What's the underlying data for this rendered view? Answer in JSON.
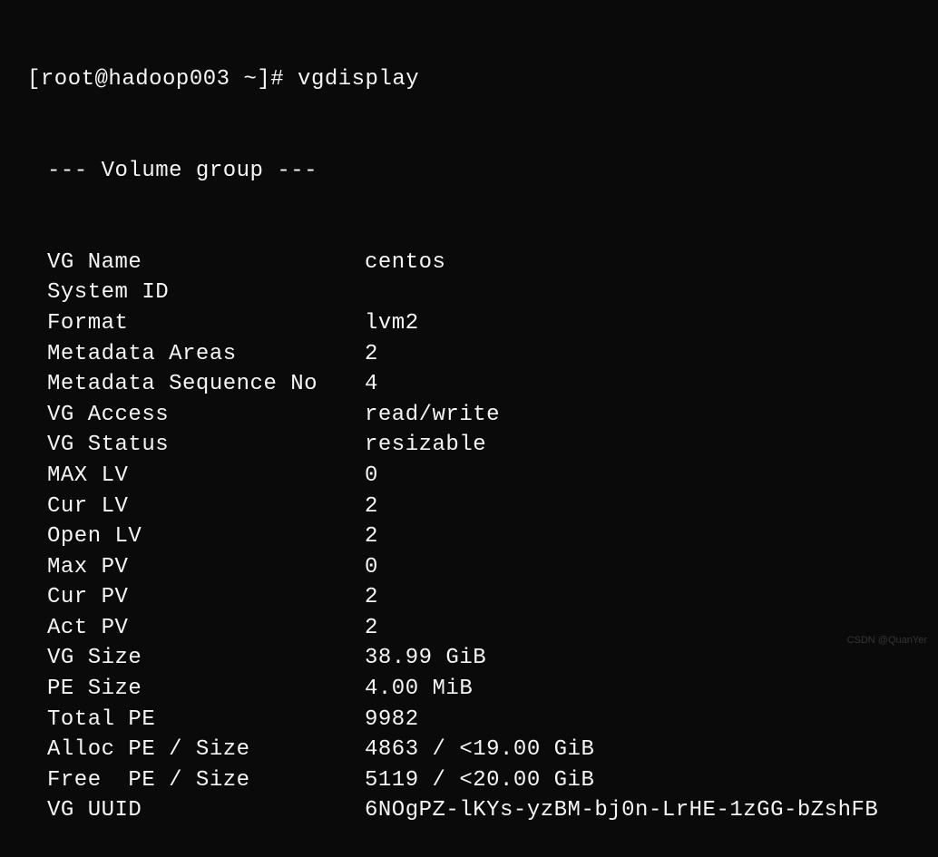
{
  "prompt": {
    "prefix": "[root@hadoop003 ~]# ",
    "command": "vgdisplay"
  },
  "header": "--- Volume group ---",
  "fields": [
    {
      "label": "VG Name",
      "value": "centos"
    },
    {
      "label": "System ID",
      "value": ""
    },
    {
      "label": "Format",
      "value": "lvm2"
    },
    {
      "label": "Metadata Areas",
      "value": "2"
    },
    {
      "label": "Metadata Sequence No",
      "value": "4"
    },
    {
      "label": "VG Access",
      "value": "read/write"
    },
    {
      "label": "VG Status",
      "value": "resizable"
    },
    {
      "label": "MAX LV",
      "value": "0"
    },
    {
      "label": "Cur LV",
      "value": "2"
    },
    {
      "label": "Open LV",
      "value": "2"
    },
    {
      "label": "Max PV",
      "value": "0"
    },
    {
      "label": "Cur PV",
      "value": "2"
    },
    {
      "label": "Act PV",
      "value": "2"
    },
    {
      "label": "VG Size",
      "value": "38.99 GiB"
    },
    {
      "label": "PE Size",
      "value": "4.00 MiB"
    },
    {
      "label": "Total PE",
      "value": "9982"
    },
    {
      "label": "Alloc PE / Size",
      "value": "4863 / <19.00 GiB"
    },
    {
      "label": "Free  PE / Size",
      "value": "5119 / <20.00 GiB"
    },
    {
      "label": "VG UUID",
      "value": "6NOgPZ-lKYs-yzBM-bj0n-LrHE-1zGG-bZshFB"
    }
  ],
  "watermark": "CSDN @QuanYer"
}
